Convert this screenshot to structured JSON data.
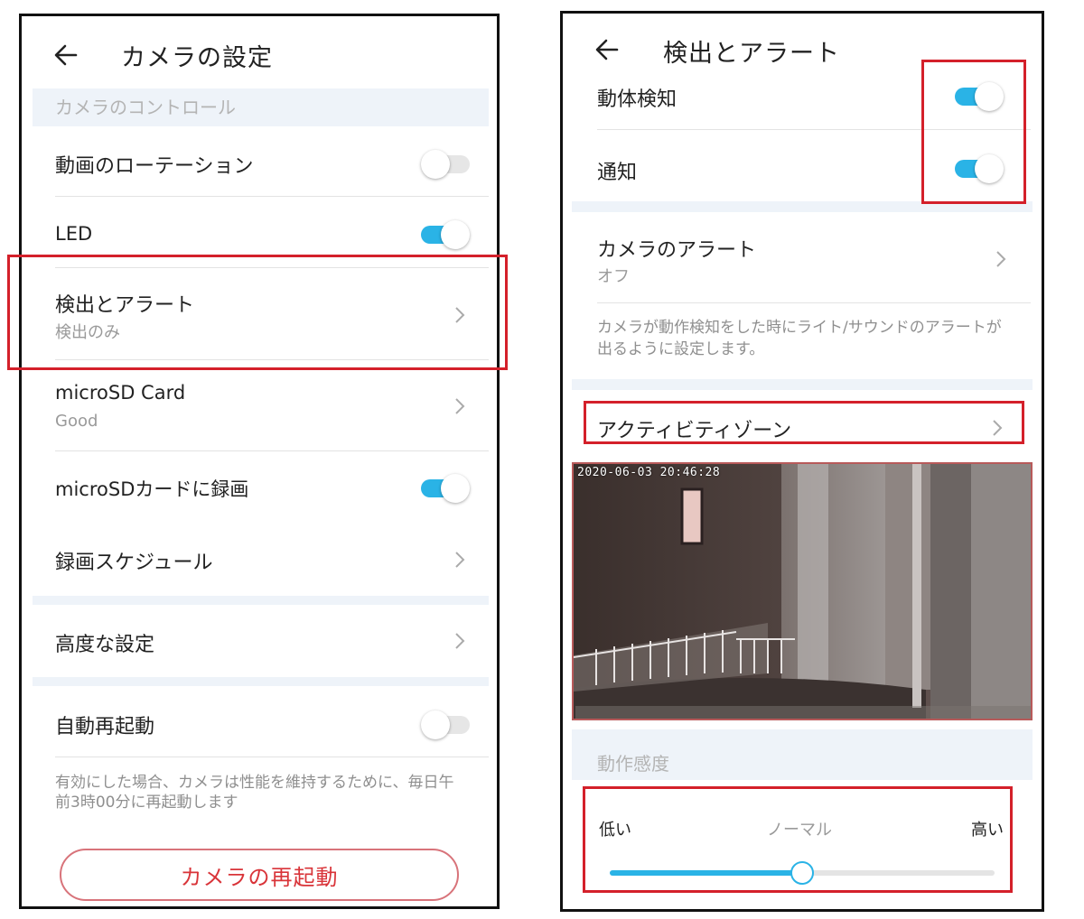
{
  "left_screen": {
    "title": "カメラの設定",
    "section_label": "カメラのコントロール",
    "rows": {
      "rotation": {
        "label": "動画のローテーション",
        "toggle": "off"
      },
      "led": {
        "label": "LED",
        "toggle": "on"
      },
      "detection": {
        "label": "検出とアラート",
        "sub": "検出のみ"
      },
      "microsd": {
        "label": "microSD Card",
        "sub": "Good"
      },
      "record_sd": {
        "label": "microSDカードに録画",
        "toggle": "on"
      },
      "schedule": {
        "label": "録画スケジュール"
      },
      "advanced": {
        "label": "高度な設定"
      },
      "auto_reboot": {
        "label": "自動再起動",
        "toggle": "off"
      }
    },
    "auto_reboot_desc": "有効にした場合、カメラは性能を維持するために、毎日午前3時00分に再起動します",
    "restart_button": "カメラの再起動"
  },
  "right_screen": {
    "title": "検出とアラート",
    "rows": {
      "motion_detect": {
        "label": "動体検知",
        "toggle": "on"
      },
      "notify": {
        "label": "通知",
        "toggle": "on"
      },
      "camera_alert": {
        "label": "カメラのアラート",
        "sub": "オフ"
      },
      "activity_zone": {
        "label": "アクティビティゾーン"
      }
    },
    "camera_alert_desc": "カメラが動作検知をした時にライト/サウンドのアラートが出るように設定します。",
    "camera_timestamp": "2020-06-03  20:46:28",
    "sensitivity": {
      "heading": "動作感度",
      "low": "低い",
      "mid": "ノーマル",
      "high": "高い",
      "value": 0.5
    }
  },
  "colors": {
    "accent": "#2ab3e6",
    "highlight": "#d4202a",
    "button_text": "#d93439"
  }
}
